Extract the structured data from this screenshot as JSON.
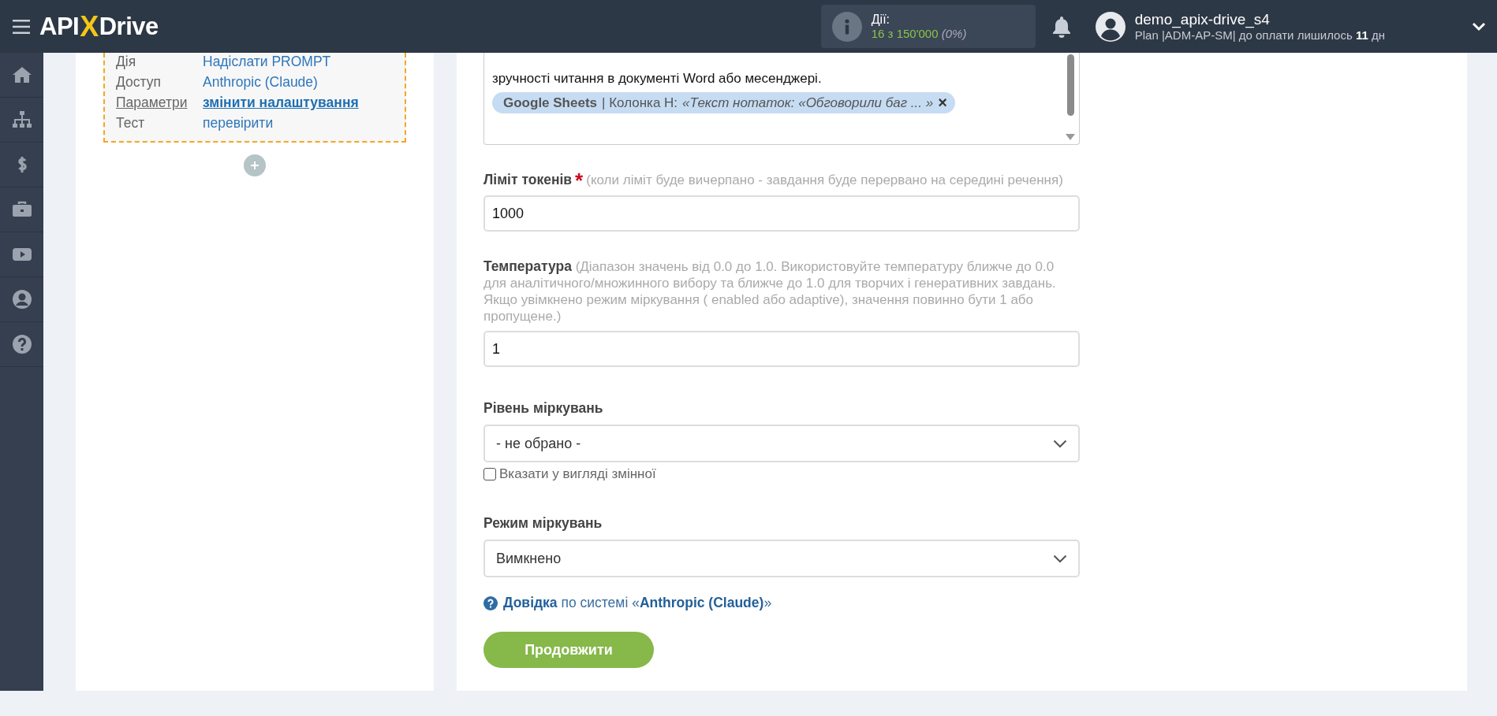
{
  "header": {
    "logo": [
      "API",
      "X",
      "Drive"
    ],
    "actions": {
      "label": "Дії:",
      "count": "16 з 150'000",
      "percent": "(0%)"
    },
    "user": {
      "name": "demo_apix-drive_s4",
      "plan": "Plan |ADM-AP-SM| до оплати лишилось **11** дн"
    }
  },
  "summary": {
    "rows": [
      {
        "label": "Дія",
        "value": "Надіслати PROMPT",
        "kind": "plain"
      },
      {
        "label": "Доступ",
        "value": "Anthropic (Claude)",
        "kind": "plain"
      },
      {
        "label": "Параметри",
        "value": "змінити налаштування",
        "kind": "link"
      },
      {
        "label": "Тест",
        "value": "перевірити",
        "kind": "plain"
      }
    ]
  },
  "form": {
    "prompt": {
      "lines": [
        "зручності читання в документі Word або месенджері."
      ],
      "tag": {
        "source": "Google Sheets",
        "column": "| Колонка H:",
        "value": "«Текст нотаток: «Обговорили баг ... »",
        "remove": "×"
      }
    },
    "fields": [
      {
        "kind": "input",
        "label": "Ліміт токенів",
        "required_mark": "*",
        "hint": "(коли ліміт буде вичерпано - завдання буде перервано на середині речення)",
        "value": "1000"
      },
      {
        "kind": "input",
        "label": "**Температура** (Діапазон значень від 0.0 до 1.0. Використовуйте температуру ближче до 0.0 для аналітичного/множинного вибору та ближче до 1.0 для творчих і генеративних завдань. Якщо увімкнено режим міркування ( enabled або adaptive), значення повинно бути 1 або пропущене.)",
        "value": "1"
      },
      {
        "kind": "select",
        "label": "Рівень міркувань",
        "value": "- не обрано -",
        "checkbox": {
          "label": "Вказати у вигляді змінної",
          "checked": false
        }
      },
      {
        "kind": "select",
        "label": "Режим міркувань",
        "value": "Вимкнено"
      }
    ],
    "help": "**Довідка** по системі «**Anthropic (Claude)**»",
    "button": "Продовжити"
  }
}
